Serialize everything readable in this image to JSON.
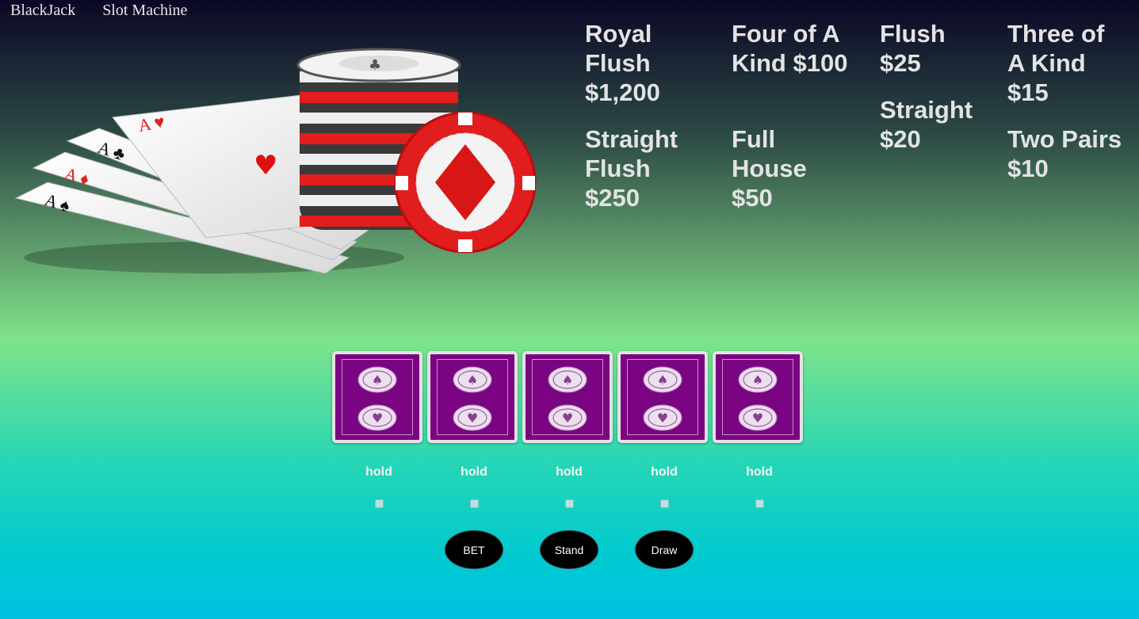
{
  "nav": {
    "items": [
      "BlackJack",
      "Slot Machine"
    ]
  },
  "payouts": {
    "royal_flush": "Royal Flush $1,200",
    "straight_flush": "Straight Flush $250",
    "four_of_a_kind": "Four of A Kind $100",
    "full_house": "Full House $50",
    "flush": "Flush $25",
    "straight": "Straight $20",
    "three_of_a_kind": "Three of A Kind $15",
    "two_pairs": "Two Pairs $10"
  },
  "hand": {
    "hold_labels": [
      "hold",
      "hold",
      "hold",
      "hold",
      "hold"
    ],
    "card_back_color": "#7b0483"
  },
  "buttons": {
    "bet": "BET",
    "stand": "Stand",
    "draw": "Draw"
  },
  "colors": {
    "card_back": "#7b0483",
    "chip_red": "#e11d1d",
    "text": "#e3e3e3"
  }
}
